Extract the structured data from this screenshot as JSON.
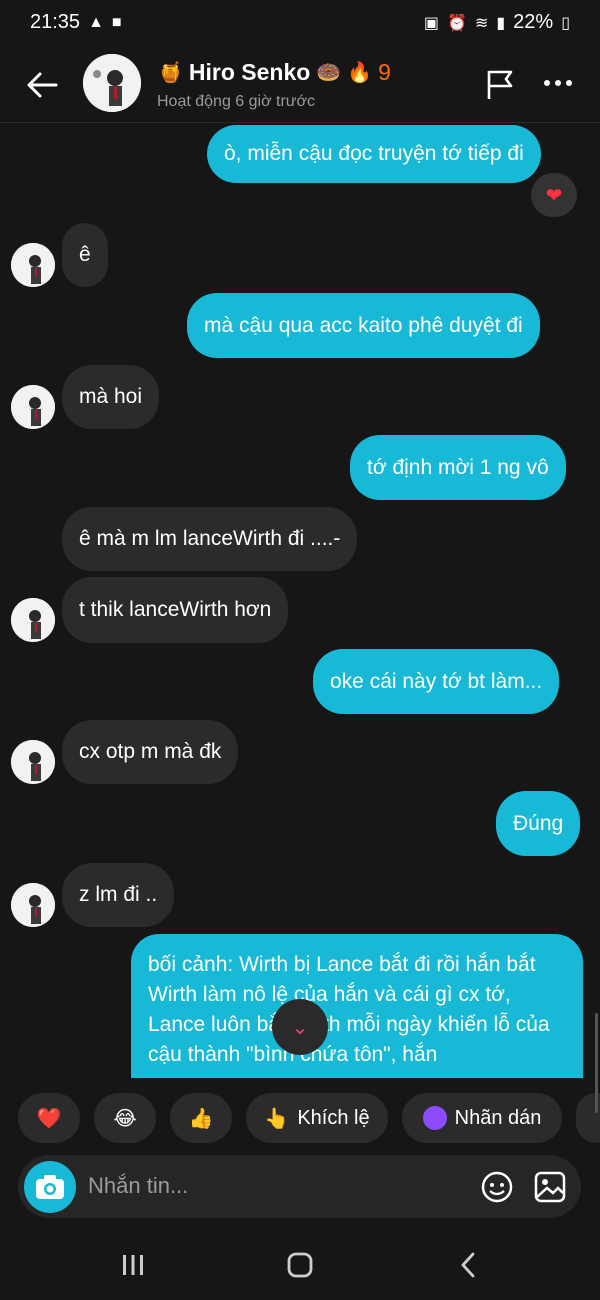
{
  "status_bar": {
    "time": "21:35",
    "battery": "22%"
  },
  "header": {
    "name": "Hiro Senko",
    "emoji_left": "🍯",
    "emoji_right": "🍩",
    "streak_icon": "🔥",
    "streak_count": "9",
    "subtitle": "Hoạt động 6 giờ trước"
  },
  "messages": {
    "out_1": "ò, miễn cậu đọc truyện tớ tiếp đi",
    "reaction_1": "❤",
    "in_1": "ê",
    "out_2": "mà cậu qua acc kaito phê duyệt đi",
    "in_2": "mà hoi",
    "out_3": "tớ định mời 1 ng vô",
    "in_3": "ê mà m lm lanceWirth đi ....-",
    "in_4": "t thik lanceWirth hơn",
    "out_4": "oke cái này tớ bt làm...",
    "in_5": "cx otp m mà đk",
    "out_5": "Đúng",
    "in_6": "z lm đi ..",
    "out_long": "bối cảnh: Wirth bị Lance bắt đi rồi hắn bắt Wirth làm nô lệ của hắn và cái gì cx tớ, Lance luôn bắt Wirth mỗi ngày khiến lỗ của cậu thành \"bình chứa tôn\", hắn"
  },
  "quick_replies": {
    "heart": "❤️",
    "laugh": "😂",
    "thumbs": "👍",
    "encourage_emoji": "👆",
    "encourage": "Khích lệ",
    "sticker": "Nhãn dán"
  },
  "composer": {
    "placeholder": "Nhắn tin..."
  },
  "colors": {
    "outgoing": "#18b9d6",
    "incoming": "#2b2b2b",
    "background": "#161616"
  }
}
